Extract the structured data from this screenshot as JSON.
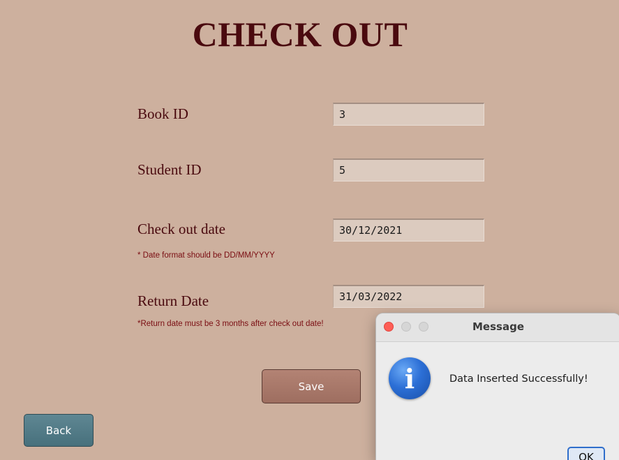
{
  "page": {
    "title": "CHECK OUT"
  },
  "form": {
    "book_id": {
      "label": "Book ID",
      "value": "3"
    },
    "student_id": {
      "label": "Student ID",
      "value": "5"
    },
    "checkout_date": {
      "label": "Check out date",
      "value": "30/12/2021",
      "hint": "* Date format should be DD/MM/YYYY"
    },
    "return_date": {
      "label": "Return Date",
      "value": "31/03/2022",
      "hint": "*Return date must be 3 months after check out date!"
    }
  },
  "buttons": {
    "save": "Save",
    "back": "Back"
  },
  "dialog": {
    "title": "Message",
    "icon": "info-icon",
    "icon_glyph": "i",
    "message": "Data Inserted Successfully!",
    "ok": "OK"
  },
  "colors": {
    "background": "#cdb09e",
    "title": "#4a0a0f",
    "save_button": "#a97a6c",
    "back_button": "#527b87"
  }
}
